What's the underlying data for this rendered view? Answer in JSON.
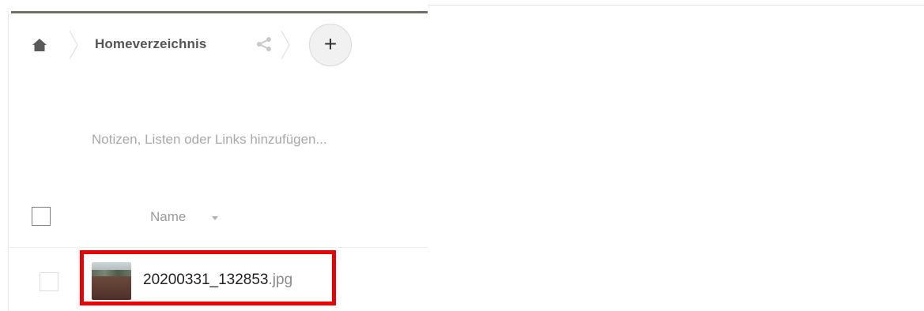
{
  "breadcrumb": {
    "home_icon": "home-icon",
    "folder": "Homeverzeichnis",
    "share_icon": "share-icon",
    "add_label": "+"
  },
  "notes": {
    "placeholder": "Notizen, Listen oder Links hinzufügen..."
  },
  "table": {
    "columns": [
      {
        "label": "Name",
        "sort": "descending"
      }
    ],
    "rows": [
      {
        "basename": "20200331_132853",
        "extension": ".jpg",
        "thumbnail": "photo-thumbnail",
        "highlighted": true
      }
    ]
  },
  "colors": {
    "accent_bar": "#706f5f",
    "highlight": "#ee0000"
  }
}
